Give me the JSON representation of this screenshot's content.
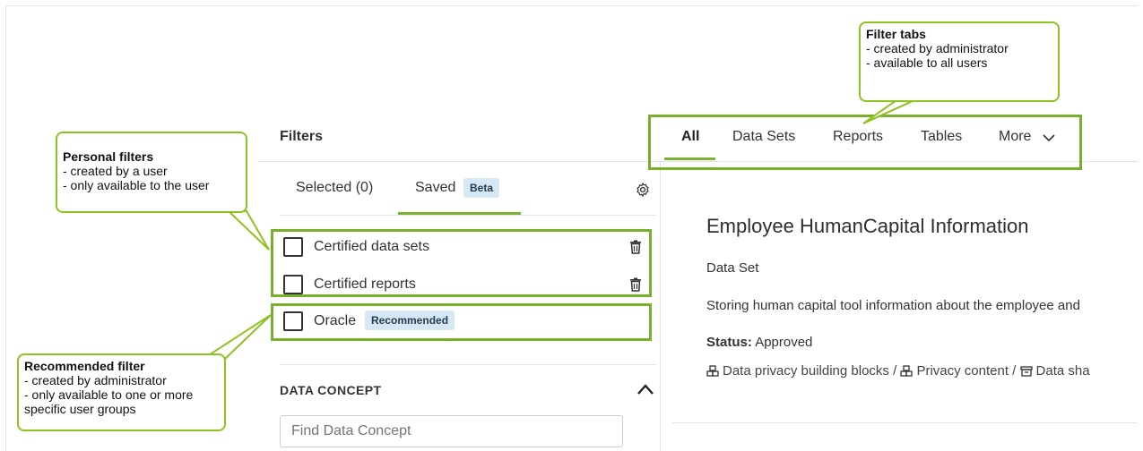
{
  "left_panel": {
    "title": "Filters",
    "tabs": {
      "selected_label": "Selected (0)",
      "saved_label": "Saved",
      "saved_badge": "Beta"
    },
    "filters": [
      {
        "label": "Certified data sets",
        "checked": false,
        "deletable": true
      },
      {
        "label": "Certified reports",
        "checked": false,
        "deletable": true
      },
      {
        "label": "Oracle",
        "badge": "Recommended",
        "checked": false,
        "deletable": false
      }
    ],
    "section": {
      "title": "DATA CONCEPT",
      "search_placeholder": "Find Data Concept"
    }
  },
  "right_tabs": [
    {
      "label": "All",
      "active": true
    },
    {
      "label": "Data Sets",
      "active": false
    },
    {
      "label": "Reports",
      "active": false
    },
    {
      "label": "Tables",
      "active": false
    },
    {
      "label": "More",
      "active": false
    }
  ],
  "detail": {
    "title": "Employee HumanCapital Information",
    "type": "Data Set",
    "description": "Storing human capital tool information about the employee and",
    "status_label": "Status:",
    "status_value": "Approved",
    "breadcrumbs": [
      "Data privacy building blocks",
      "Privacy content",
      "Data sha"
    ]
  },
  "callouts": {
    "filter_tabs": {
      "title": "Filter tabs",
      "lines": [
        "- created by administrator",
        "- available to all users"
      ]
    },
    "personal": {
      "title": "Personal filters",
      "lines": [
        "- created by a user",
        "- only available to the user"
      ]
    },
    "recommended": {
      "title": "Recommended filter",
      "lines": [
        "- created by administrator",
        "- only available to one or more",
        "specific user groups"
      ]
    }
  },
  "colors": {
    "accent": "#7ab32e",
    "callout_border": "#8ec21f",
    "badge_bg": "#d6e8f4"
  },
  "icons": [
    "gear-icon",
    "trash-icon",
    "chevron-down-icon",
    "chevron-up-icon",
    "building-blocks-icon",
    "archive-icon"
  ]
}
